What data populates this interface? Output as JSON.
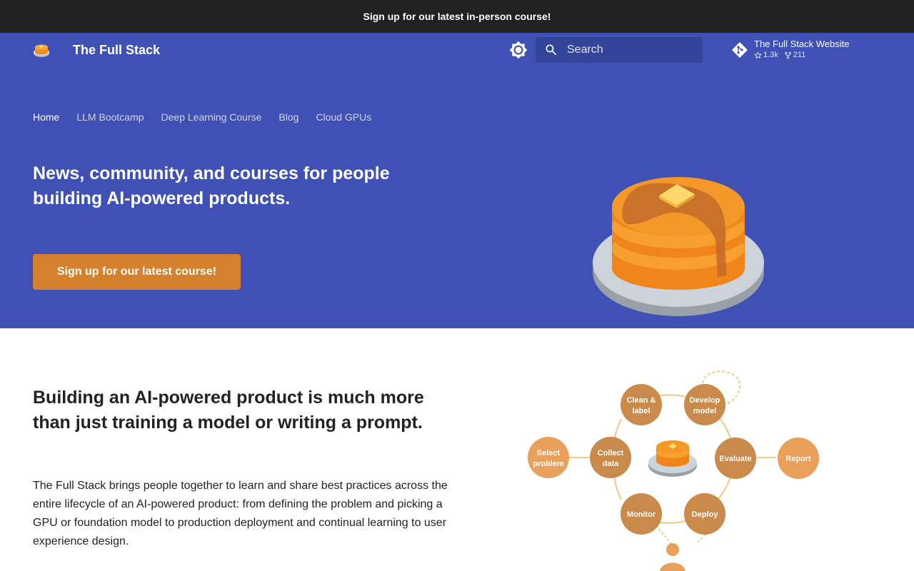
{
  "announcement": "Sign up for our latest in-person course!",
  "header": {
    "site_title": "The Full Stack",
    "search_placeholder": "Search",
    "repo": {
      "name": "The Full Stack Website",
      "stars": "1.3k",
      "forks": "211"
    }
  },
  "nav": {
    "tabs": [
      {
        "label": "Home",
        "active": true
      },
      {
        "label": "LLM Bootcamp"
      },
      {
        "label": "Deep Learning Course"
      },
      {
        "label": "Blog"
      },
      {
        "label": "Cloud GPUs"
      }
    ]
  },
  "hero": {
    "title": "News, community, and courses for people building AI-powered products.",
    "cta_label": "Sign up for our latest course!"
  },
  "content": {
    "lead": "Building an AI-powered product is much more than just training a model or writing a prompt.",
    "paragraph": "The Full Stack brings people together to learn and share best practices across the entire lifecycle of an AI-powered product: from defining the problem and picking a GPU or foundation model to production deployment and continual learning to user experience design."
  },
  "diagram": {
    "select_1": "Select",
    "select_2": "problem",
    "collect_1": "Collect",
    "collect_2": "data",
    "clean_1": "Clean &",
    "clean_2": "label",
    "develop_1": "Develop",
    "develop_2": "model",
    "evaluate": "Evaluate",
    "report": "Report",
    "deploy": "Deploy",
    "monitor": "Monitor"
  },
  "colors": {
    "primary": "#3f51b5",
    "topbar": "#212121",
    "accent": "#d4802c",
    "node_dark": "#c98a4b",
    "node_light": "#e9a05a"
  }
}
